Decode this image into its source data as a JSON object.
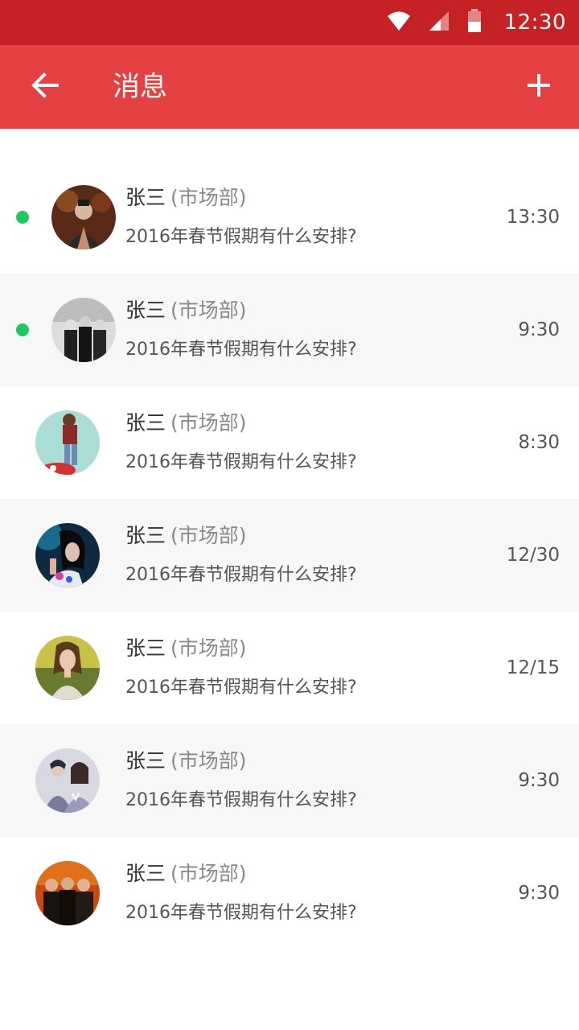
{
  "status_bar": {
    "time": "12:30",
    "icons": [
      "wifi-icon",
      "signal-icon",
      "battery-icon"
    ]
  },
  "app_bar": {
    "title": "消息",
    "back_icon": "arrow-left-icon",
    "add_icon": "plus-icon",
    "color": "#e54042"
  },
  "messages": [
    {
      "name": "张三",
      "dept": "(市场部)",
      "preview": "2016年春节假期有什么安排?",
      "time": "13:30",
      "unread": true
    },
    {
      "name": "张三",
      "dept": "(市场部)",
      "preview": "2016年春节假期有什么安排?",
      "time": "9:30",
      "unread": true
    },
    {
      "name": "张三",
      "dept": "(市场部)",
      "preview": "2016年春节假期有什么安排?",
      "time": "8:30",
      "unread": false
    },
    {
      "name": "张三",
      "dept": "(市场部)",
      "preview": "2016年春节假期有什么安排?",
      "time": "12/30",
      "unread": false
    },
    {
      "name": "张三",
      "dept": "(市场部)",
      "preview": "2016年春节假期有什么安排?",
      "time": "12/15",
      "unread": false
    },
    {
      "name": "张三",
      "dept": "(市场部)",
      "preview": "2016年春节假期有什么安排?",
      "time": "9:30",
      "unread": false
    },
    {
      "name": "张三",
      "dept": "(市场部)",
      "preview": "2016年春节假期有什么安排?",
      "time": "9:30",
      "unread": false
    }
  ],
  "colors": {
    "status_bar": "#c62125",
    "unread_dot": "#1fc760",
    "row_alt": "#f7f7f7"
  }
}
